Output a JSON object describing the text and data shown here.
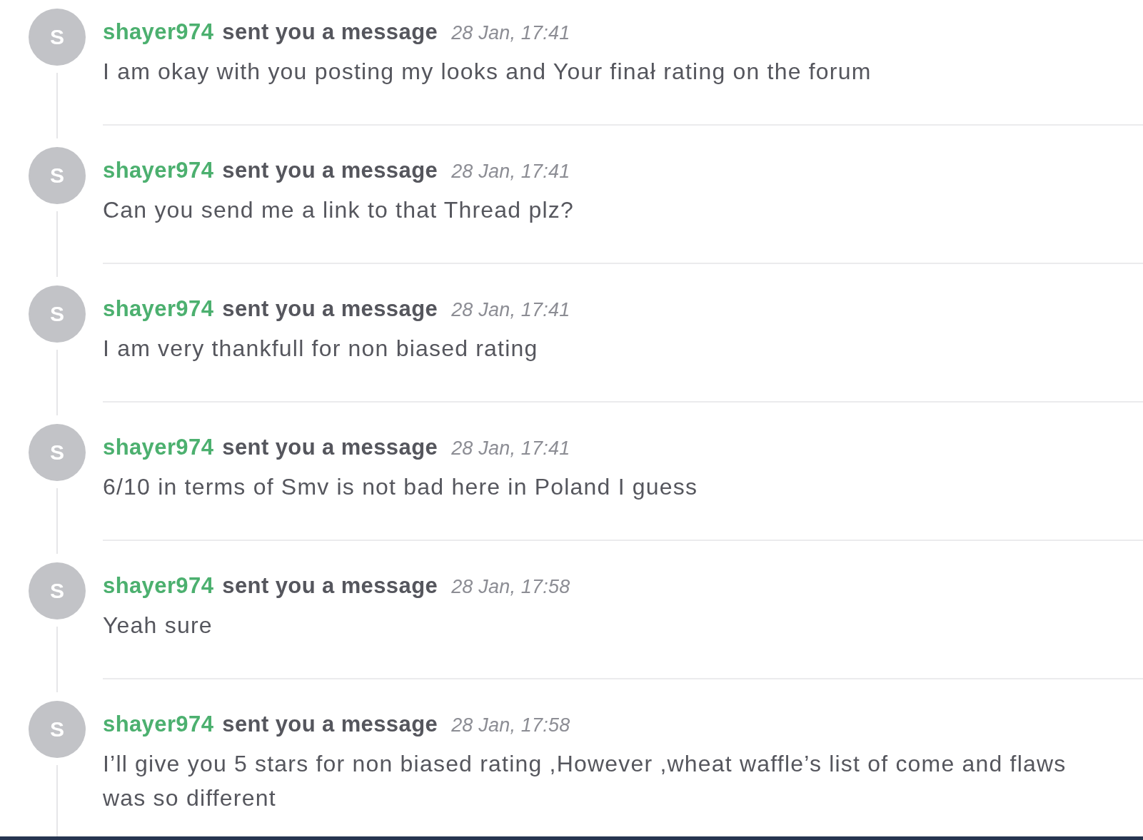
{
  "messages": [
    {
      "avatar_initial": "S",
      "sender": "shayer974",
      "action": "sent you a message",
      "time": "28 Jan, 17:41",
      "text": "I am okay with you posting my looks and Your finał rating on the forum"
    },
    {
      "avatar_initial": "S",
      "sender": "shayer974",
      "action": "sent you a message",
      "time": "28 Jan, 17:41",
      "text": "Can you send me a link to that Thread plz?"
    },
    {
      "avatar_initial": "S",
      "sender": "shayer974",
      "action": "sent you a message",
      "time": "28 Jan, 17:41",
      "text": "I am very thankfull for non biased rating"
    },
    {
      "avatar_initial": "S",
      "sender": "shayer974",
      "action": "sent you a message",
      "time": "28 Jan, 17:41",
      "text": "6/10 in terms of Smv is not bad here in Poland I guess"
    },
    {
      "avatar_initial": "S",
      "sender": "shayer974",
      "action": "sent you a message",
      "time": "28 Jan, 17:58",
      "text": "Yeah sure"
    },
    {
      "avatar_initial": "S",
      "sender": "shayer974",
      "action": "sent you a message",
      "time": "28 Jan, 17:58",
      "text": "I’ll give you 5 stars for non biased rating ,However ,wheat waffle’s list of come and flaws was so different"
    }
  ]
}
